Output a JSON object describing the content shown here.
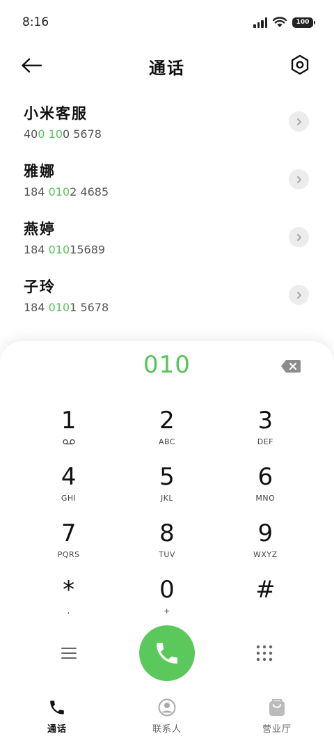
{
  "status_bar": {
    "time": "8:16",
    "battery": "100",
    "icons": [
      "signal-icon",
      "wifi-icon",
      "battery-icon"
    ]
  },
  "header": {
    "title": "通话",
    "back_icon": "back-arrow-icon",
    "settings_icon": "settings-icon"
  },
  "contacts": [
    {
      "name": "小米客服",
      "number_parts": [
        "40",
        "0 10",
        "0 5678"
      ]
    },
    {
      "name": "雅娜",
      "number_parts": [
        "184 ",
        "010",
        "2 4685"
      ]
    },
    {
      "name": "燕婷",
      "number_parts": [
        "184 ",
        "010",
        "15689"
      ]
    },
    {
      "name": "子玲",
      "number_parts": [
        "184 ",
        "010",
        "1 5678"
      ]
    }
  ],
  "dialer": {
    "input": "010",
    "keys": [
      {
        "digit": "1",
        "letters": ""
      },
      {
        "digit": "2",
        "letters": "ABC"
      },
      {
        "digit": "3",
        "letters": "DEF"
      },
      {
        "digit": "4",
        "letters": "GHI"
      },
      {
        "digit": "5",
        "letters": "JKL"
      },
      {
        "digit": "6",
        "letters": "MNO"
      },
      {
        "digit": "7",
        "letters": "PQRS"
      },
      {
        "digit": "8",
        "letters": "TUV"
      },
      {
        "digit": "9",
        "letters": "WXYZ"
      },
      {
        "digit": "*",
        "letters": ","
      },
      {
        "digit": "0",
        "letters": "+"
      },
      {
        "digit": "#",
        "letters": ""
      }
    ]
  },
  "tabs": [
    {
      "label": "通话",
      "icon": "phone-icon",
      "active": true
    },
    {
      "label": "联系人",
      "icon": "contacts-icon",
      "active": false
    },
    {
      "label": "营业厅",
      "icon": "store-icon",
      "active": false
    }
  ],
  "colors": {
    "accent_green": "#59c25a",
    "call_button": "#5ac85b"
  }
}
